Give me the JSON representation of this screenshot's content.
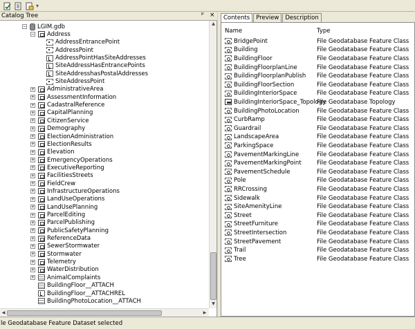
{
  "toolbar": {
    "icons": [
      "metadata-validate-icon",
      "metadata-edit-icon",
      "metadata-export-icon"
    ]
  },
  "catalog": {
    "title": "Catalog Tree",
    "gdb": "LGIM.gdb",
    "address_dataset": "Address",
    "address_children": [
      "AddressEntrancePoint",
      "AddressPoint",
      "AddressPointHasSiteAddresses",
      "SiteAddressHasEntrancePoints",
      "SiteAddresshasPostalAddresses",
      "SiteAddressPoint"
    ],
    "datasets": [
      "AdministrativeArea",
      "AssessmentInformation",
      "CadastralReference",
      "CapitalPlanning",
      "CitizenService",
      "Demography",
      "ElectionAdministration",
      "ElectionResults",
      "Elevation",
      "EmergencyOperations",
      "ExecutiveReporting",
      "FacilitiesStreets",
      "FieldCrew",
      "InfrastructureOperations",
      "LandUseOperations",
      "LandUsePlanning",
      "ParcelEditing",
      "ParcelPublishing",
      "PublicSafetyPlanning",
      "ReferenceData",
      "SewerStormwater",
      "Stormwater",
      "Telemetry",
      "WaterDistribution"
    ],
    "tables": [
      {
        "label": "AnimalComplaints",
        "icon": "table"
      },
      {
        "label": "BuildingFloor__ATTACH",
        "icon": "table"
      },
      {
        "label": "BuildingFloor__ATTACHREL",
        "icon": "rel"
      },
      {
        "label": "BuildingPhotoLocation__ATTACH",
        "icon": "table"
      }
    ]
  },
  "contents": {
    "tabs": [
      "Contents",
      "Preview",
      "Description"
    ],
    "col_name": "Name",
    "col_type": "Type",
    "rows": [
      {
        "name": "BridgePoint",
        "type": "File Geodatabase Feature Class"
      },
      {
        "name": "Building",
        "type": "File Geodatabase Feature Class"
      },
      {
        "name": "BuildingFloor",
        "type": "File Geodatabase Feature Class"
      },
      {
        "name": "BuildingFloorplanLine",
        "type": "File Geodatabase Feature Class"
      },
      {
        "name": "BuildingFloorplanPublish",
        "type": "File Geodatabase Feature Class"
      },
      {
        "name": "BuildingFloorSection",
        "type": "File Geodatabase Feature Class"
      },
      {
        "name": "BuildingInteriorSpace",
        "type": "File Geodatabase Feature Class"
      },
      {
        "name": "BuildingInteriorSpace_Topology",
        "type": "File Geodatabase Topology",
        "icon": "topo"
      },
      {
        "name": "BuildingPhotoLocation",
        "type": "File Geodatabase Feature Class"
      },
      {
        "name": "CurbRamp",
        "type": "File Geodatabase Feature Class"
      },
      {
        "name": "Guardrail",
        "type": "File Geodatabase Feature Class"
      },
      {
        "name": "LandscapeArea",
        "type": "File Geodatabase Feature Class"
      },
      {
        "name": "ParkingSpace",
        "type": "File Geodatabase Feature Class"
      },
      {
        "name": "PavementMarkingLine",
        "type": "File Geodatabase Feature Class"
      },
      {
        "name": "PavementMarkingPoint",
        "type": "File Geodatabase Feature Class"
      },
      {
        "name": "PavementSchedule",
        "type": "File Geodatabase Feature Class"
      },
      {
        "name": "Pole",
        "type": "File Geodatabase Feature Class"
      },
      {
        "name": "RRCrossing",
        "type": "File Geodatabase Feature Class"
      },
      {
        "name": "Sidewalk",
        "type": "File Geodatabase Feature Class"
      },
      {
        "name": "SiteAmenityLine",
        "type": "File Geodatabase Feature Class"
      },
      {
        "name": "Street",
        "type": "File Geodatabase Feature Class"
      },
      {
        "name": "StreetFurniture",
        "type": "File Geodatabase Feature Class"
      },
      {
        "name": "StreetIntersection",
        "type": "File Geodatabase Feature Class"
      },
      {
        "name": "StreetPavement",
        "type": "File Geodatabase Feature Class"
      },
      {
        "name": "Trail",
        "type": "File Geodatabase Feature Class"
      },
      {
        "name": "Tree",
        "type": "File Geodatabase Feature Class"
      }
    ]
  },
  "status": {
    "text": "le Geodatabase Feature Dataset selected"
  }
}
